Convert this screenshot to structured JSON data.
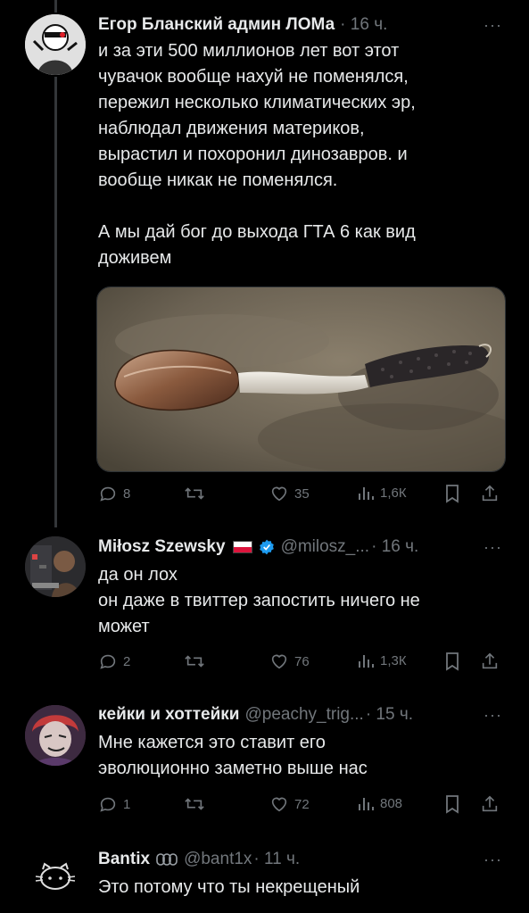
{
  "tweets": [
    {
      "author": "Егор Бланский админ ЛОМа",
      "time": "· 16 ч.",
      "more": "···",
      "lines": [
        "и за эти 500 миллионов лет вот этот",
        "чувачок вообще нахуй не поменялся,",
        "пережил несколько климатических эр,",
        "наблюдал движения материков,",
        "вырастил и похоронил динозавров. и",
        "вообще никак не поменялся.",
        "",
        "А мы дай бог до выхода ГТА 6 как вид",
        "доживем"
      ],
      "replies": "8",
      "likes": "35",
      "views": "1,6К"
    },
    {
      "author": "Miłosz Szewsky",
      "handle": "@milosz_...",
      "time": "· 16 ч.",
      "more": "···",
      "lines": [
        "да он лох",
        "он даже в твиттер запостить ничего не",
        "может"
      ],
      "replies": "2",
      "likes": "76",
      "views": "1,3К"
    },
    {
      "author": "кейки и хоттейки",
      "handle": "@peachy_trig...",
      "time": "· 15 ч.",
      "more": "···",
      "lines": [
        "Мне кажется это ставит его",
        "эволюционно заметно выше нас"
      ],
      "replies": "1",
      "likes": "72",
      "views": "808"
    },
    {
      "author": "Bantix",
      "handle": "@bant1x",
      "time": "· 11 ч.",
      "more": "···",
      "lines": [
        "Это потому что ты некрещеный"
      ]
    }
  ],
  "icons": {
    "reply": "reply-icon",
    "retweet": "retweet-icon",
    "like": "heart-icon",
    "views": "views-icon",
    "bookmark": "bookmark-icon",
    "share": "share-icon"
  },
  "colors": {
    "background": "#000000",
    "text": "#e7e9ea",
    "secondary": "#71767b",
    "verified": "#1d9bf0",
    "thread_line": "#333639"
  }
}
